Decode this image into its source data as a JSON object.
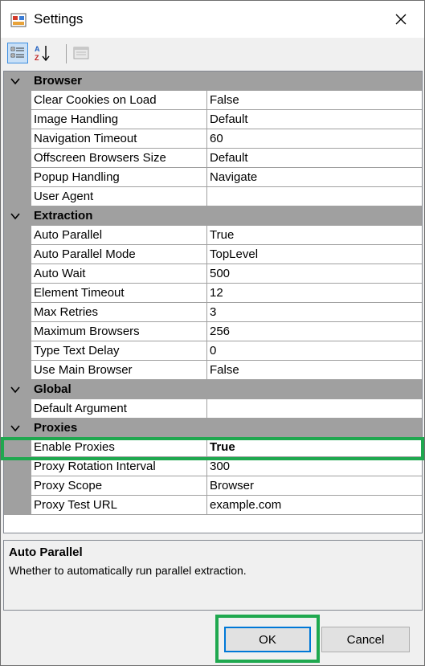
{
  "window": {
    "title": "Settings"
  },
  "toolbar": {
    "categorized_tooltip": "Categorized",
    "alphabetical_tooltip": "Alphabetical",
    "property_pages_tooltip": "Property Pages"
  },
  "grid": {
    "categories": [
      {
        "name": "Browser",
        "properties": [
          {
            "name": "Clear Cookies on Load",
            "value": "False"
          },
          {
            "name": "Image Handling",
            "value": "Default"
          },
          {
            "name": "Navigation Timeout",
            "value": "60"
          },
          {
            "name": "Offscreen Browsers Size",
            "value": "Default"
          },
          {
            "name": "Popup Handling",
            "value": "Navigate"
          },
          {
            "name": "User Agent",
            "value": ""
          }
        ]
      },
      {
        "name": "Extraction",
        "properties": [
          {
            "name": "Auto Parallel",
            "value": "True"
          },
          {
            "name": "Auto Parallel Mode",
            "value": "TopLevel"
          },
          {
            "name": "Auto Wait",
            "value": "500"
          },
          {
            "name": "Element Timeout",
            "value": "12"
          },
          {
            "name": "Max Retries",
            "value": "3"
          },
          {
            "name": "Maximum Browsers",
            "value": "256"
          },
          {
            "name": "Type Text Delay",
            "value": "0"
          },
          {
            "name": "Use Main Browser",
            "value": "False"
          }
        ]
      },
      {
        "name": "Global",
        "properties": [
          {
            "name": "Default Argument",
            "value": ""
          }
        ]
      },
      {
        "name": "Proxies",
        "properties": [
          {
            "name": "Enable Proxies",
            "value": "True"
          },
          {
            "name": "Proxy Rotation Interval",
            "value": "300"
          },
          {
            "name": "Proxy Scope",
            "value": "Browser"
          },
          {
            "name": "Proxy Test URL",
            "value": "example.com"
          }
        ]
      }
    ]
  },
  "help": {
    "title": "Auto Parallel",
    "description": "Whether to automatically run parallel extraction."
  },
  "buttons": {
    "ok": "OK",
    "cancel": "Cancel"
  },
  "colors": {
    "highlight": "#1fa84f",
    "accent": "#0078d7"
  }
}
